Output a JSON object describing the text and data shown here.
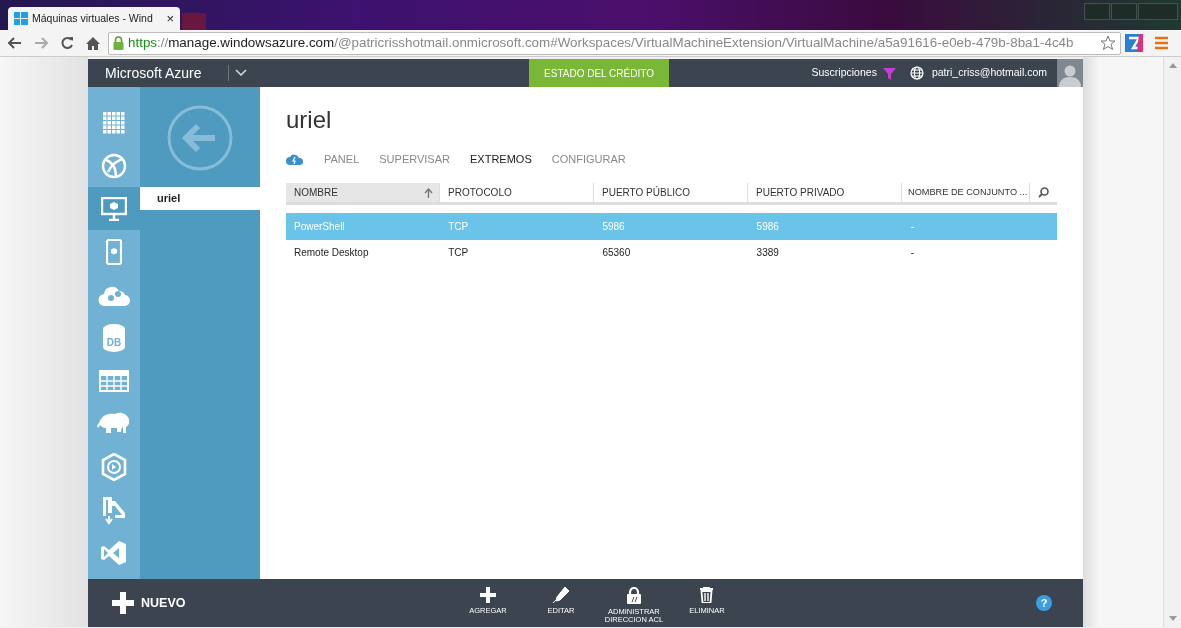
{
  "browser": {
    "tab_title": "Máquinas virtuales - Wind",
    "tab_close": "×",
    "url_parts": [
      {
        "text": "https",
        "kind": "scheme"
      },
      {
        "text": "://",
        "kind": "path"
      },
      {
        "text": "manage.windowsazure.com",
        "kind": "host"
      },
      {
        "text": "/@patricrisshotmail.onmicrosoft.com#Workspaces/VirtualMachineExtension/VirtualMachine/a5a91616-e0eb-479b-8ba1-4c4b",
        "kind": "path"
      }
    ]
  },
  "header": {
    "brand": "Microsoft Azure",
    "credit_button": "ESTADO DEL CRÉDITO",
    "subscriptions": "Suscripciones",
    "user": "patri_criss@hotmail.com"
  },
  "rail": [
    {
      "kind": "grid",
      "selected": false
    },
    {
      "kind": "web",
      "selected": false
    },
    {
      "kind": "vm",
      "selected": true
    },
    {
      "kind": "mobile",
      "selected": false
    },
    {
      "kind": "cloud",
      "selected": false
    },
    {
      "kind": "db",
      "label": "DB",
      "selected": false
    },
    {
      "kind": "table",
      "selected": false
    },
    {
      "kind": "elephant",
      "selected": false
    },
    {
      "kind": "media",
      "selected": false
    },
    {
      "kind": "import",
      "selected": false
    },
    {
      "kind": "vs",
      "selected": false
    }
  ],
  "panel": {
    "items": [
      {
        "label": "uriel",
        "selected": true
      }
    ]
  },
  "main": {
    "title": "uriel",
    "tabs": [
      {
        "label": "PANEL",
        "selected": false
      },
      {
        "label": "SUPERVISAR",
        "selected": false
      },
      {
        "label": "EXTREMOS",
        "selected": true
      },
      {
        "label": "CONFIGURAR",
        "selected": false
      }
    ],
    "table": {
      "columns": [
        {
          "label": "NOMBRE",
          "sorted": true
        },
        {
          "label": "PROTOCOLO",
          "sorted": false
        },
        {
          "label": "PUERTO PÚBLICO",
          "sorted": false
        },
        {
          "label": "PUERTO PRIVADO",
          "sorted": false
        },
        {
          "label": "NOMBRE DE CONJUNTO ...",
          "sorted": false
        }
      ],
      "rows": [
        {
          "cells": [
            "PowerShell",
            "TCP",
            "5986",
            "5986",
            "-"
          ],
          "selected": true
        },
        {
          "cells": [
            "Remote Desktop",
            "TCP",
            "65360",
            "3389",
            "-"
          ],
          "selected": false
        }
      ]
    }
  },
  "command_bar": {
    "new_button": "NUEVO",
    "actions": [
      {
        "label": "AGREGAR",
        "kind": "add"
      },
      {
        "label": "EDITAR",
        "kind": "edit"
      },
      {
        "label": "ADMINISTRAR DIRECCION ACL",
        "kind": "lock"
      },
      {
        "label": "ELIMINAR",
        "kind": "delete"
      }
    ],
    "help": "?"
  }
}
